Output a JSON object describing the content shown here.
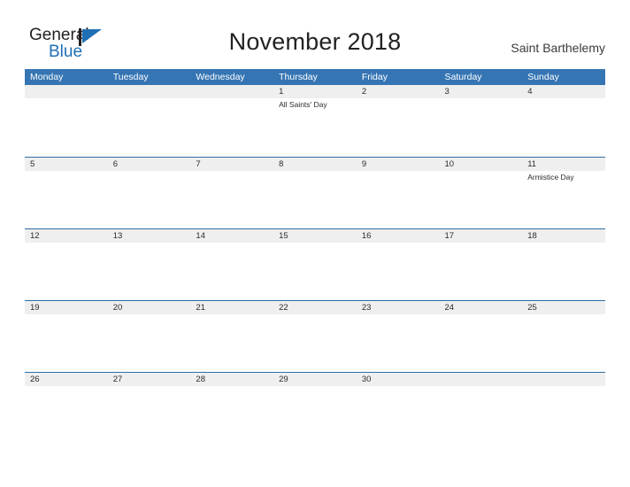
{
  "brand": {
    "name_part1": "General",
    "name_part2": "Blue",
    "accent_color": "#1f6fb5",
    "logo_icon": "triangle-flag-icon"
  },
  "header": {
    "title": "November 2018",
    "location": "Saint Barthelemy"
  },
  "calendar": {
    "header_color": "#3575b4",
    "row_border_color": "#2e6da4",
    "datebar_color": "#efefef",
    "weekdays": [
      "Monday",
      "Tuesday",
      "Wednesday",
      "Thursday",
      "Friday",
      "Saturday",
      "Sunday"
    ],
    "weeks": [
      [
        {
          "day": "",
          "event": ""
        },
        {
          "day": "",
          "event": ""
        },
        {
          "day": "",
          "event": ""
        },
        {
          "day": "1",
          "event": "All Saints' Day"
        },
        {
          "day": "2",
          "event": ""
        },
        {
          "day": "3",
          "event": ""
        },
        {
          "day": "4",
          "event": ""
        }
      ],
      [
        {
          "day": "5",
          "event": ""
        },
        {
          "day": "6",
          "event": ""
        },
        {
          "day": "7",
          "event": ""
        },
        {
          "day": "8",
          "event": ""
        },
        {
          "day": "9",
          "event": ""
        },
        {
          "day": "10",
          "event": ""
        },
        {
          "day": "11",
          "event": "Armistice Day"
        }
      ],
      [
        {
          "day": "12",
          "event": ""
        },
        {
          "day": "13",
          "event": ""
        },
        {
          "day": "14",
          "event": ""
        },
        {
          "day": "15",
          "event": ""
        },
        {
          "day": "16",
          "event": ""
        },
        {
          "day": "17",
          "event": ""
        },
        {
          "day": "18",
          "event": ""
        }
      ],
      [
        {
          "day": "19",
          "event": ""
        },
        {
          "day": "20",
          "event": ""
        },
        {
          "day": "21",
          "event": ""
        },
        {
          "day": "22",
          "event": ""
        },
        {
          "day": "23",
          "event": ""
        },
        {
          "day": "24",
          "event": ""
        },
        {
          "day": "25",
          "event": ""
        }
      ],
      [
        {
          "day": "26",
          "event": ""
        },
        {
          "day": "27",
          "event": ""
        },
        {
          "day": "28",
          "event": ""
        },
        {
          "day": "29",
          "event": ""
        },
        {
          "day": "30",
          "event": ""
        },
        {
          "day": "",
          "event": ""
        },
        {
          "day": "",
          "event": ""
        }
      ]
    ]
  }
}
